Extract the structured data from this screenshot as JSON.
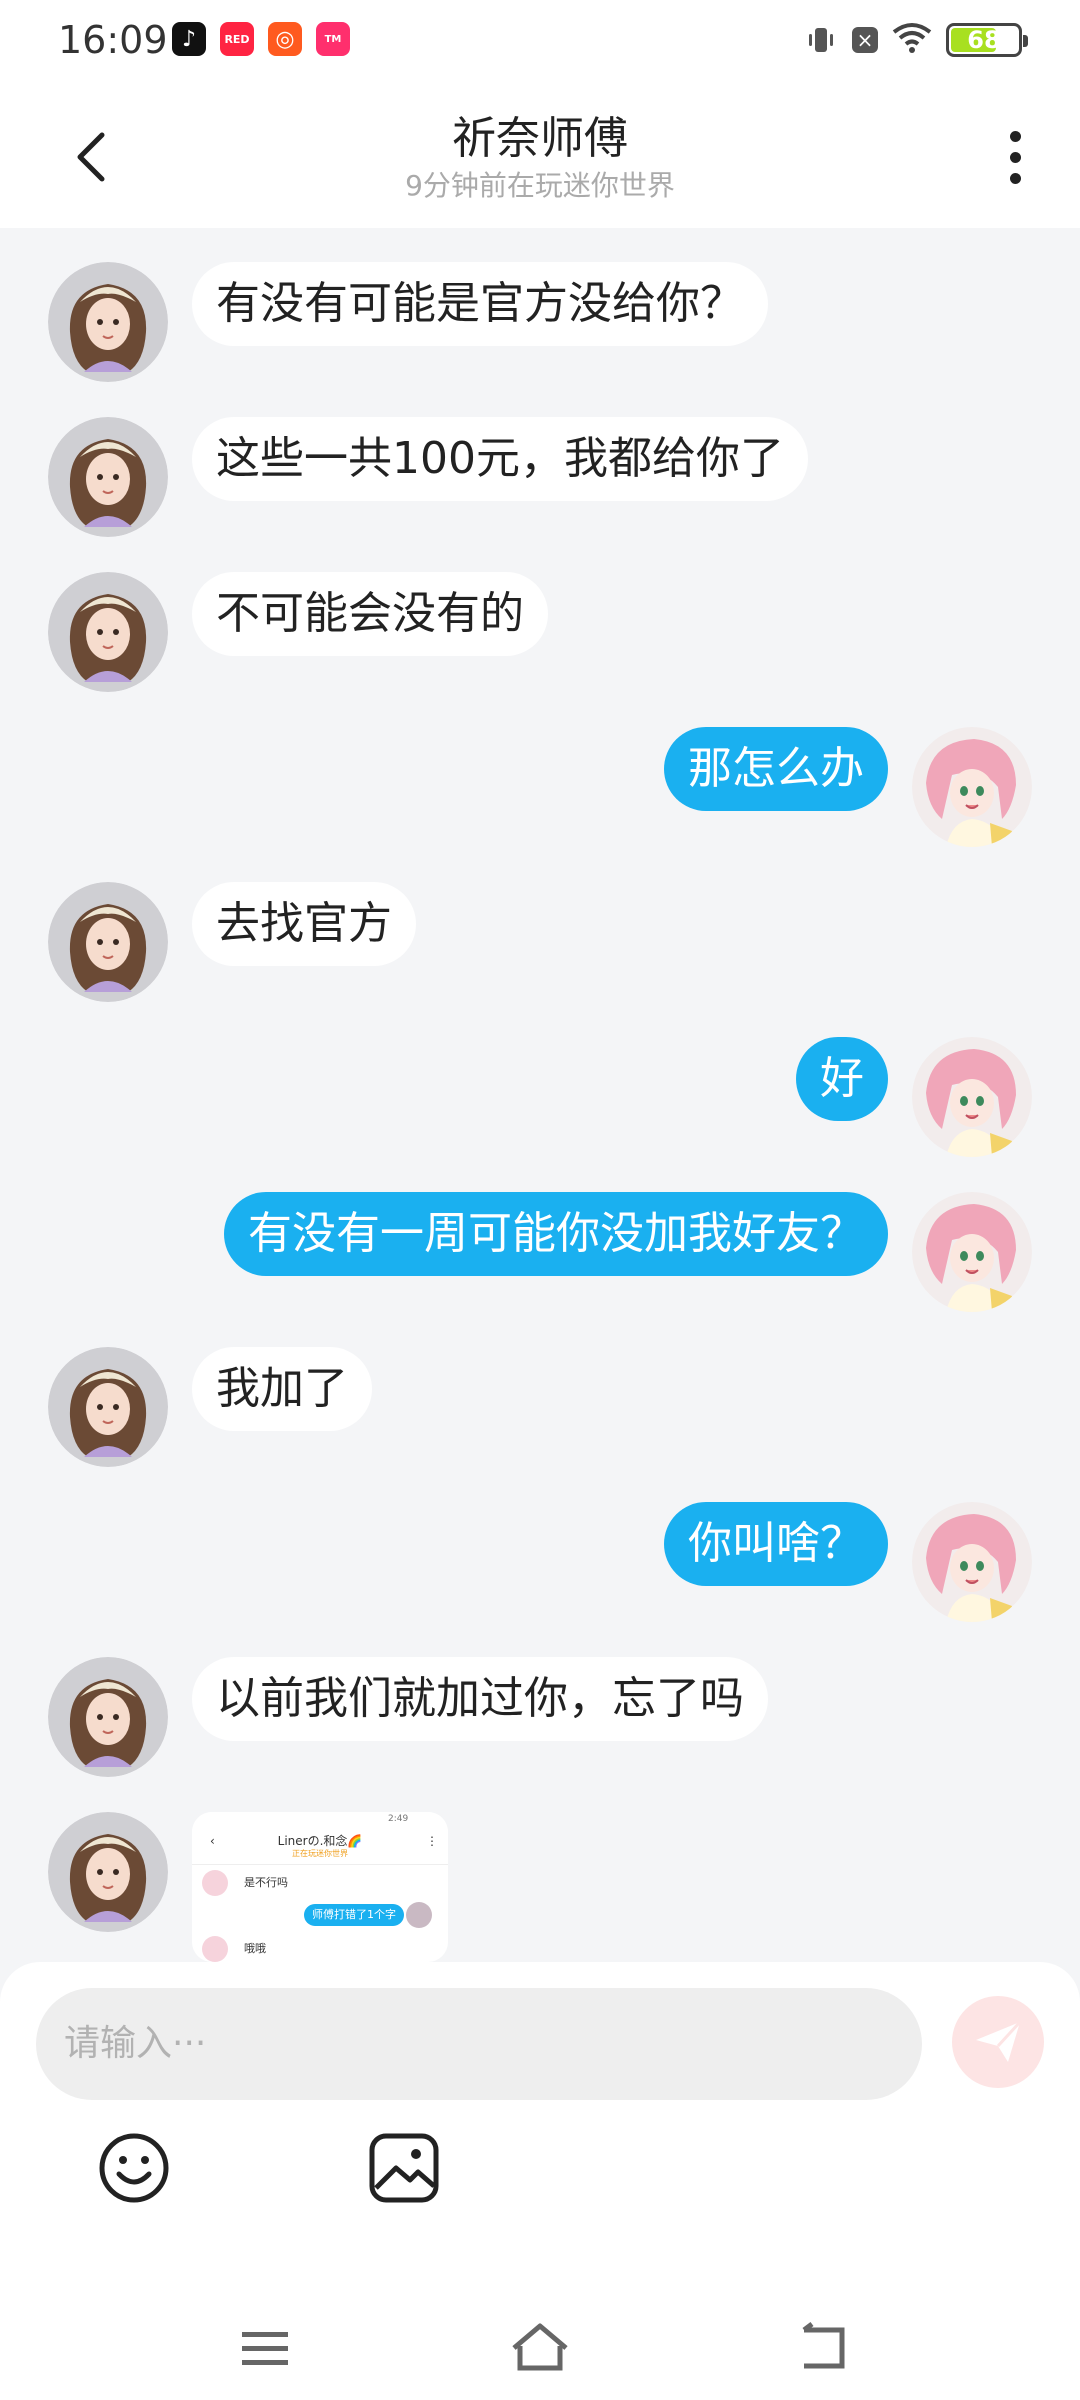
{
  "status_bar": {
    "time": "16:09",
    "battery": "68",
    "battery_level": 0.68,
    "apps": [
      "tiktok-icon",
      "xiaohongshu-icon",
      "kuaishou-icon",
      "tmall-icon"
    ]
  },
  "header": {
    "title": "祈奈师傅",
    "subtitle": "9分钟前在玩迷你世界"
  },
  "messages": [
    {
      "side": "in",
      "text": "有没有可能是官方没给你？"
    },
    {
      "side": "in",
      "text": "这些一共100元，我都给你了"
    },
    {
      "side": "in",
      "text": "不可能会没有的"
    },
    {
      "side": "out",
      "text": "那怎么办"
    },
    {
      "side": "in",
      "text": "去找官方"
    },
    {
      "side": "out",
      "text": "好"
    },
    {
      "side": "out",
      "text": "有没有一周可能你没加我好友？"
    },
    {
      "side": "in",
      "text": "我加了"
    },
    {
      "side": "out",
      "text": "你叫啥？"
    },
    {
      "side": "in",
      "text": "以前我们就加过你，忘了吗"
    }
  ],
  "image_message": {
    "title": "Linerの.和念🌈",
    "sub": "正在玩迷你世界",
    "time": "2:49",
    "line1": "是不行吗",
    "line2": "师傅打错了1个字",
    "line3": "哦哦"
  },
  "composer": {
    "placeholder": "请输入···"
  },
  "colors": {
    "accent": "#1ab0f0",
    "background": "#f4f5f7",
    "send_disabled": "#fde4e4"
  }
}
